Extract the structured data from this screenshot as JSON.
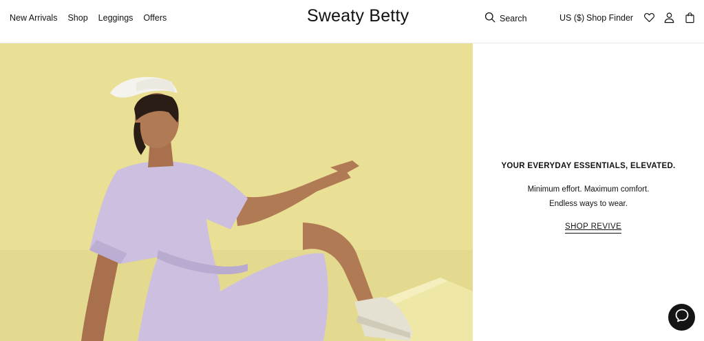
{
  "nav": {
    "items": [
      "New Arrivals",
      "Shop",
      "Leggings",
      "Offers"
    ]
  },
  "brand": {
    "name": "Sweaty Betty"
  },
  "header": {
    "search_label": "Search",
    "currency_label": "US ($)",
    "shop_finder_label": "Shop Finder"
  },
  "promo": {
    "title": "YOUR EVERYDAY ESSENTIALS, ELEVATED.",
    "line1": "Minimum effort. Maximum comfort.",
    "line2": "Endless ways to wear.",
    "cta": "SHOP REVIVE"
  },
  "icons": {
    "search": "search-icon",
    "wishlist": "heart-icon",
    "account": "user-icon",
    "bag": "bag-icon",
    "chat": "chat-icon"
  },
  "colors": {
    "hero_background": "#e8de93",
    "dress": "#cdbfe0",
    "chat_button": "#141414"
  }
}
